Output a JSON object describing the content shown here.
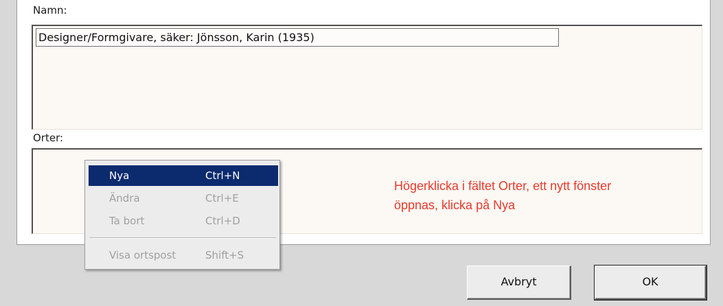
{
  "dialog": {
    "namn_label": "Namn:",
    "namn_selected": "Designer/Formgivare, säker: Jönsson, Karin  (1935)",
    "orter_label": "Orter:",
    "hint_line1": "Högerklicka i fältet Orter, ett nytt fönster",
    "hint_line2": "öppnas, klicka på Nya",
    "hint_color": "#e8392a"
  },
  "context_menu": {
    "items": [
      {
        "label": "Nya",
        "shortcut": "Ctrl+N",
        "enabled": true,
        "highlighted": true
      },
      {
        "label": "Ändra",
        "shortcut": "Ctrl+E",
        "enabled": false
      },
      {
        "label": "Ta bort",
        "shortcut": "Ctrl+D",
        "enabled": false
      },
      {
        "label": "Visa ortspost",
        "shortcut": "Shift+S",
        "enabled": false
      }
    ],
    "highlight_color": "#0c2a6e"
  },
  "buttons": {
    "cancel_label": "Avbryt",
    "ok_label": "OK"
  }
}
